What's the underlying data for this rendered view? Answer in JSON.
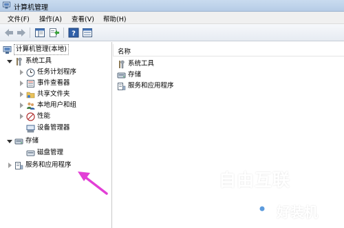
{
  "window": {
    "title": "计算机管理"
  },
  "menu": [
    {
      "label": "文件(F)"
    },
    {
      "label": "操作(A)"
    },
    {
      "label": "查看(V)"
    },
    {
      "label": "帮助(H)"
    }
  ],
  "toolbar": {
    "buttons": [
      "back-arrow-icon",
      "forward-arrow-icon",
      "show-hide-tree-icon",
      "export-list-icon",
      "help-icon",
      "properties-icon"
    ]
  },
  "tree": {
    "root": "计算机管理(本地)",
    "system_tools": "系统工具",
    "task_scheduler": "任务计划程序",
    "event_viewer": "事件查看器",
    "shared_folders": "共享文件夹",
    "local_users": "本地用户和组",
    "performance": "性能",
    "device_manager": "设备管理器",
    "storage": "存储",
    "disk_management": "磁盘管理",
    "services_apps": "服务和应用程序"
  },
  "list": {
    "column_name": "名称",
    "items": [
      "系统工具",
      "存储",
      "服务和应用程序"
    ]
  },
  "watermark": {
    "brand_top": "自由互联",
    "brand_bottom": "好装机"
  },
  "colors": {
    "arrow": "#e23fd6",
    "selection_border": "#888888"
  }
}
